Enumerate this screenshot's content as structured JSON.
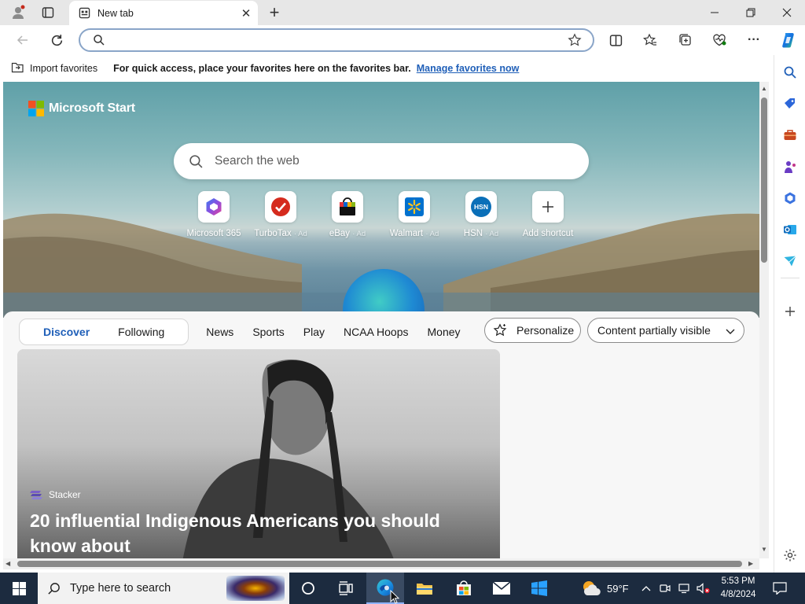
{
  "browser": {
    "tab_title": "New tab",
    "address_value": "",
    "address_placeholder": ""
  },
  "favorites_bar": {
    "import_label": "Import favorites",
    "tip": "For quick access, place your favorites here on the favorites bar.",
    "manage_link": "Manage favorites now"
  },
  "page": {
    "brand": "Microsoft Start",
    "search_placeholder": "Search the web",
    "shortcuts": [
      {
        "label": "Microsoft 365",
        "ad": "",
        "icon": "microsoft-365-icon"
      },
      {
        "label": "TurboTax",
        "ad": "· Ad",
        "icon": "turbotax-icon"
      },
      {
        "label": "eBay",
        "ad": "· Ad",
        "icon": "ebay-icon"
      },
      {
        "label": "Walmart",
        "ad": "· Ad",
        "icon": "walmart-icon"
      },
      {
        "label": "HSN",
        "ad": "· Ad",
        "icon": "hsn-icon",
        "icon_text": "HSN"
      },
      {
        "label": "Add shortcut",
        "ad": "",
        "icon": "plus-icon"
      }
    ],
    "feed_nav": {
      "discover": "Discover",
      "following": "Following",
      "items": [
        "News",
        "Sports",
        "Play",
        "NCAA Hoops",
        "Money"
      ],
      "more": "···",
      "personalize": "Personalize",
      "content_visibility": "Content partially visible"
    },
    "card": {
      "source": "Stacker",
      "title": "20 influential Indigenous Americans you should know about"
    }
  },
  "taskbar": {
    "search_placeholder": "Type here to search",
    "weather": "59°F",
    "time": "5:53 PM",
    "date": "4/8/2024"
  },
  "colors": {
    "accent": "#1f5fb8",
    "taskbar": "#1c2b3f",
    "titlebar": "#e7e7e7"
  }
}
